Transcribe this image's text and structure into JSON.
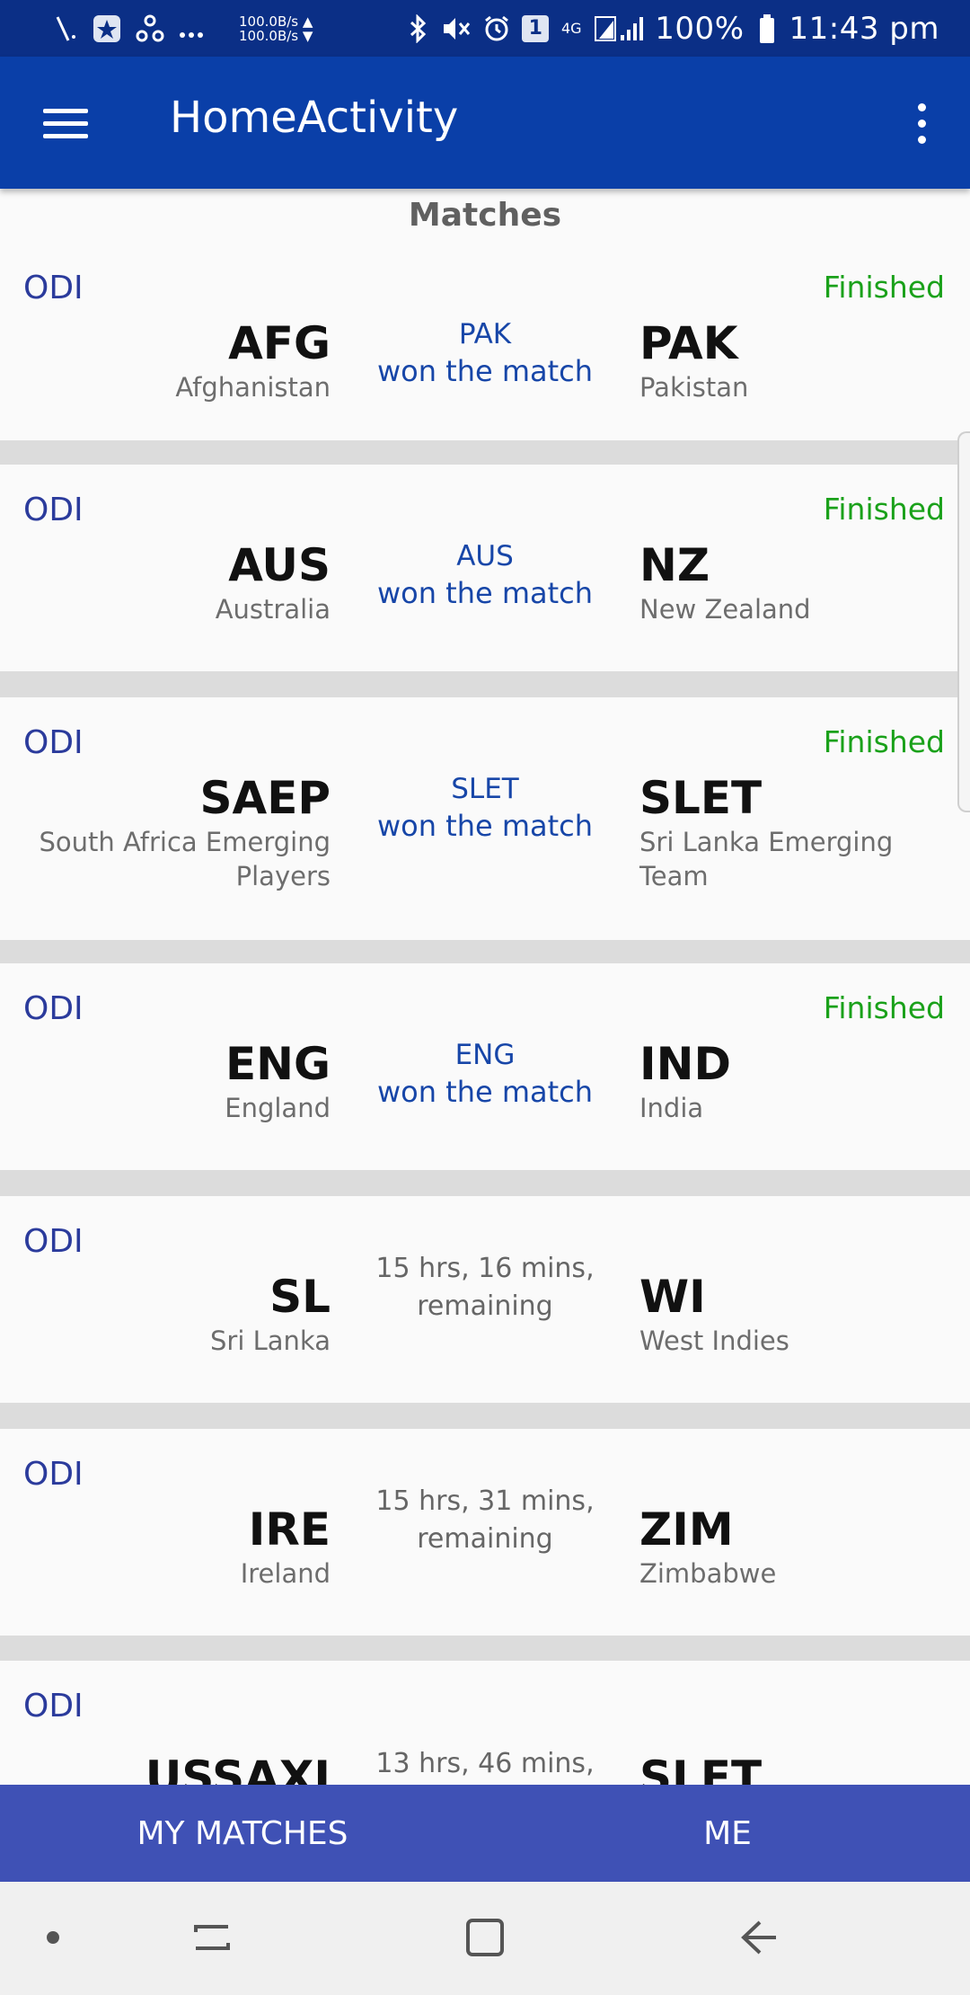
{
  "status_bar": {
    "speed_up": "100.0B/s ▲",
    "speed_down": "100.0B/s ▼",
    "sim_badge": "1",
    "network_label": "4G",
    "battery": "100%",
    "time": "11:43 pm",
    "icons": [
      "signal-icon",
      "app-icon",
      "share-icon",
      "more-notifications-icon",
      "bluetooth-icon",
      "mute-icon",
      "alarm-icon",
      "sim-icon",
      "roaming-signal-icon",
      "battery-icon"
    ]
  },
  "app_bar": {
    "title": "HomeActivity",
    "icons": [
      "menu-icon",
      "more-vert-icon"
    ]
  },
  "section_title": "Matches",
  "matches": [
    {
      "format": "ODI",
      "status": "Finished",
      "team1_abbr": "AFG",
      "team1_name": "Afghanistan",
      "result_line1": "PAK",
      "result_line2": "won the match",
      "team2_abbr": "PAK",
      "team2_name": "Pakistan"
    },
    {
      "format": "ODI",
      "status": "Finished",
      "team1_abbr": "AUS",
      "team1_name": "Australia",
      "result_line1": "AUS",
      "result_line2": "won the match",
      "team2_abbr": "NZ",
      "team2_name": "New Zealand"
    },
    {
      "format": "ODI",
      "status": "Finished",
      "team1_abbr": "SAEP",
      "team1_name_line1": "South Africa Emerging",
      "team1_name_line2": "Players",
      "result_line1": "SLET",
      "result_line2": "won the match",
      "team2_abbr": "SLET",
      "team2_name_line1": "Sri Lanka Emerging",
      "team2_name_line2": "Team"
    },
    {
      "format": "ODI",
      "status": "Finished",
      "team1_abbr": "ENG",
      "team1_name": "England",
      "result_line1": "ENG",
      "result_line2": "won the match",
      "team2_abbr": "IND",
      "team2_name": "India"
    },
    {
      "format": "ODI",
      "status": "",
      "team1_abbr": "SL",
      "team1_name": "Sri Lanka",
      "result_line1": "15 hrs, 16 mins,",
      "result_line2": "remaining",
      "team2_abbr": "WI",
      "team2_name": "West Indies"
    },
    {
      "format": "ODI",
      "status": "",
      "team1_abbr": "IRE",
      "team1_name": "Ireland",
      "result_line1": "15 hrs, 31 mins,",
      "result_line2": "remaining",
      "team2_abbr": "ZIM",
      "team2_name": "Zimbabwe"
    },
    {
      "format": "ODI",
      "status": "",
      "team1_abbr": "USSAXI",
      "result_line1": "13 hrs, 46 mins,",
      "team2_abbr": "SLET"
    }
  ],
  "bottom_nav": {
    "tab1": "MY MATCHES",
    "tab2": "ME"
  },
  "system_nav": {
    "icons": [
      "dot-icon",
      "recent-apps-icon",
      "home-icon",
      "back-icon"
    ]
  },
  "colors": {
    "status_bar": "#0b2f86",
    "app_bar": "#0a3fa8",
    "bottom_bar": "#3f51b5",
    "finished": "#1aa11a",
    "result": "#1746a8",
    "format": "#2b3b9c"
  }
}
